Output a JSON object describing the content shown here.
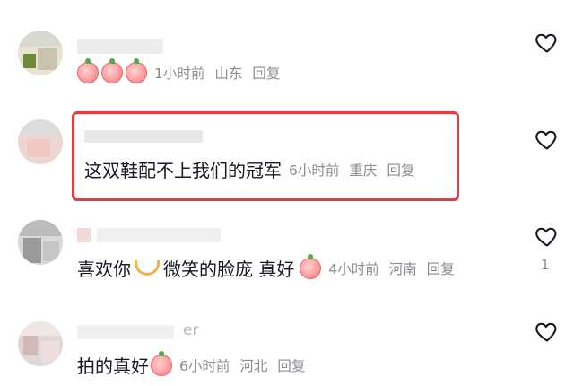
{
  "colors": {
    "highlight_border": "#e8393f",
    "meta_text": "#8a8b91",
    "body_text": "#161823"
  },
  "comments": [
    {
      "text": "",
      "emojis": [
        "peach-emoji",
        "peach-emoji",
        "peach-emoji"
      ],
      "time": "1小时前",
      "location": "山东",
      "reply": "回复",
      "likes": ""
    },
    {
      "text": "这双鞋配不上我们的冠军",
      "time": "6小时前",
      "location": "重庆",
      "reply": "回复",
      "likes": ""
    },
    {
      "text_before": "喜欢你",
      "text_middle": "微笑的脸庞 真好",
      "emojis": [
        "heart-hands-emoji",
        "peach-emoji"
      ],
      "time": "4小时前",
      "location": "河南",
      "reply": "回复",
      "likes": "1"
    },
    {
      "text": "拍的真好",
      "username_tail": "er",
      "emojis": [
        "peach-emoji"
      ],
      "time": "6小时前",
      "location": "河北",
      "reply": "回复",
      "likes": ""
    }
  ],
  "icons": {
    "like": "heart-outline-icon"
  }
}
